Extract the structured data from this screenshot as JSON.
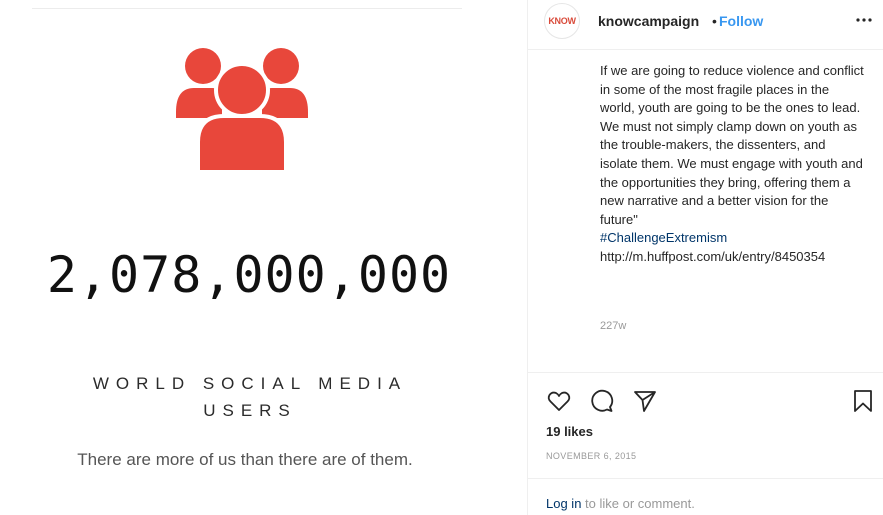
{
  "graphic": {
    "icon": "people-group-icon",
    "accent_color": "#e8473b",
    "number": "2,078,000,000",
    "headline_line1": "WORLD SOCIAL MEDIA",
    "headline_line2": "USERS",
    "tagline": "There are more of us than there are of them."
  },
  "post": {
    "avatar_text": "KNOW",
    "username": "knowcampaign",
    "separator": "•",
    "follow_label": "Follow",
    "more_icon": "more-options-icon",
    "caption_text": "If we are going to reduce violence and conflict in some of the most fragile places in the world, youth are going to be the ones to lead. We must not simply clamp down on youth as the trouble-makers, the dissenters, and isolate them. We must engage with youth and the opportunities they bring, offering them a new narrative and a better vision for the future\"",
    "hashtag": "#ChallengeExtremism",
    "link": "http://m.huffpost.com/uk/entry/8450354",
    "time_ago": "227w",
    "likes": "19 likes",
    "date": "NOVEMBER 6, 2015",
    "login_link": "Log in",
    "login_rest": " to like or comment.",
    "link_color": "#3897f0",
    "hashtag_color": "#003569"
  }
}
